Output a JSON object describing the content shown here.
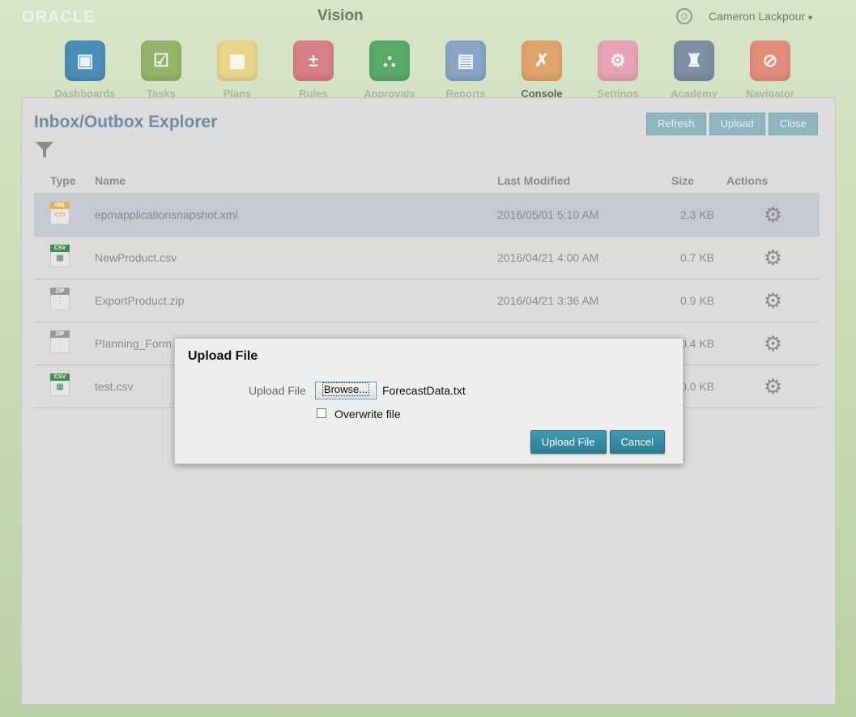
{
  "header": {
    "logo": "ORACLE",
    "app_title": "Vision",
    "accessibility_icon": "accessibility-icon",
    "user_name": "Cameron Lackpour",
    "nav": [
      {
        "label": "Dashboards",
        "icon": "dashboard-icon",
        "color": "#4a8fb8",
        "glyph": "▣"
      },
      {
        "label": "Tasks",
        "icon": "tasks-icon",
        "color": "#93b468",
        "glyph": "☑"
      },
      {
        "label": "Plans",
        "icon": "plans-icon",
        "color": "#e9d48a",
        "glyph": "▦"
      },
      {
        "label": "Rules",
        "icon": "rules-icon",
        "color": "#d77f86",
        "glyph": "±"
      },
      {
        "label": "Approvals",
        "icon": "approvals-icon",
        "color": "#5aaa6c",
        "glyph": "⛬"
      },
      {
        "label": "Reports",
        "icon": "reports-icon",
        "color": "#86a4c4",
        "glyph": "▤"
      },
      {
        "label": "Console",
        "icon": "console-icon",
        "color": "#e0a46a",
        "glyph": "✗",
        "active": true
      },
      {
        "label": "Settings",
        "icon": "settings-icon",
        "color": "#e8a4b4",
        "glyph": "⚙"
      },
      {
        "label": "Academy",
        "icon": "academy-icon",
        "color": "#7e8fa4",
        "glyph": "♜"
      },
      {
        "label": "Navigator",
        "icon": "navigator-icon",
        "color": "#e48c7c",
        "glyph": "⊘"
      }
    ]
  },
  "panel": {
    "title": "Inbox/Outbox Explorer",
    "filter_icon": "filter-icon",
    "toolbar": {
      "refresh": "Refresh",
      "upload": "Upload",
      "close": "Close"
    },
    "columns": {
      "type": "Type",
      "name": "Name",
      "modified": "Last Modified",
      "size": "Size",
      "actions": "Actions"
    },
    "rows": [
      {
        "type": "XML",
        "icon": "xml-file-icon",
        "tag_color": "#e8b050",
        "name": "epmapplicationsnapshot.xml",
        "modified": "2016/05/01 5:10 AM",
        "size": "2.3 KB",
        "selected": true
      },
      {
        "type": "CSV",
        "icon": "csv-file-icon",
        "tag_color": "#3f8d4f",
        "name": "NewProduct.csv",
        "modified": "2016/04/21 4:00 AM",
        "size": "0.7 KB"
      },
      {
        "type": "ZIP",
        "icon": "zip-file-icon",
        "tag_color": "#9a9a9a",
        "name": "ExportProduct.zip",
        "modified": "2016/04/21 3:36 AM",
        "size": "0.9 KB"
      },
      {
        "type": "ZIP",
        "icon": "zip-file-icon",
        "tag_color": "#9a9a9a",
        "name": "Planning_Form",
        "modified": "",
        "size": "0.4 KB"
      },
      {
        "type": "CSV",
        "icon": "csv-file-icon",
        "tag_color": "#3f8d4f",
        "name": "test.csv",
        "modified": "",
        "size": "0.0 KB"
      }
    ]
  },
  "dialog": {
    "title": "Upload File",
    "field_label": "Upload File",
    "browse_label": "Browse...",
    "file_name": "ForecastData.txt",
    "overwrite_label": "Overwrite file",
    "overwrite_checked": false,
    "upload_button": "Upload File",
    "cancel_button": "Cancel"
  }
}
